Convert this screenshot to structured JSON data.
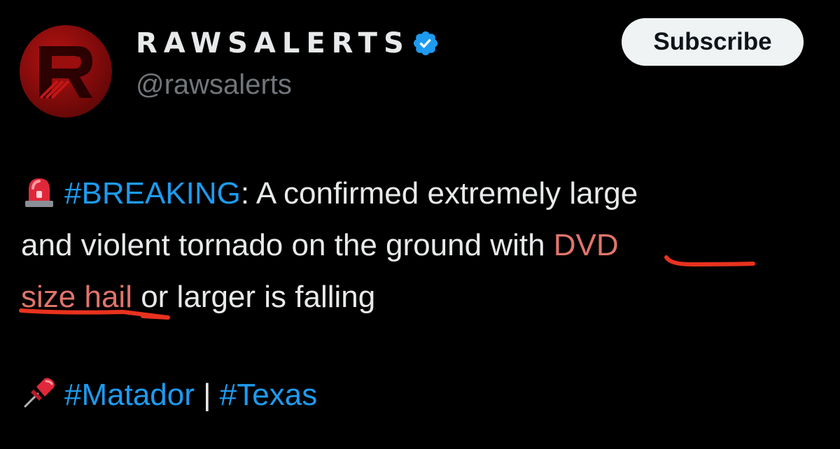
{
  "header": {
    "display_name": "RAWSALERTS",
    "handle": "@rawsalerts",
    "subscribe_label": "Subscribe"
  },
  "body": {
    "emoji_icon": "police-siren-icon",
    "breaking_tag": "#BREAKING",
    "line1_rest": ": A confirmed  extremely large",
    "line2_text": "and violent tornado on the ground with ",
    "line2_highlight": "DVD",
    "line3_highlight": "size hail",
    "line3_rest": " or larger is falling"
  },
  "tags": {
    "pin_icon": "pushpin-icon",
    "tag1": "#Matador",
    "separator": " | ",
    "tag2": "#Texas"
  },
  "colors": {
    "background": "#000000",
    "text": "#e7e9ea",
    "secondary_text": "#71767b",
    "link": "#1d9bf0",
    "verified_badge": "#1d9bf0",
    "highlight_text": "#e0746a",
    "underline_mark": "#e8321e",
    "avatar_red": "#b51313"
  }
}
